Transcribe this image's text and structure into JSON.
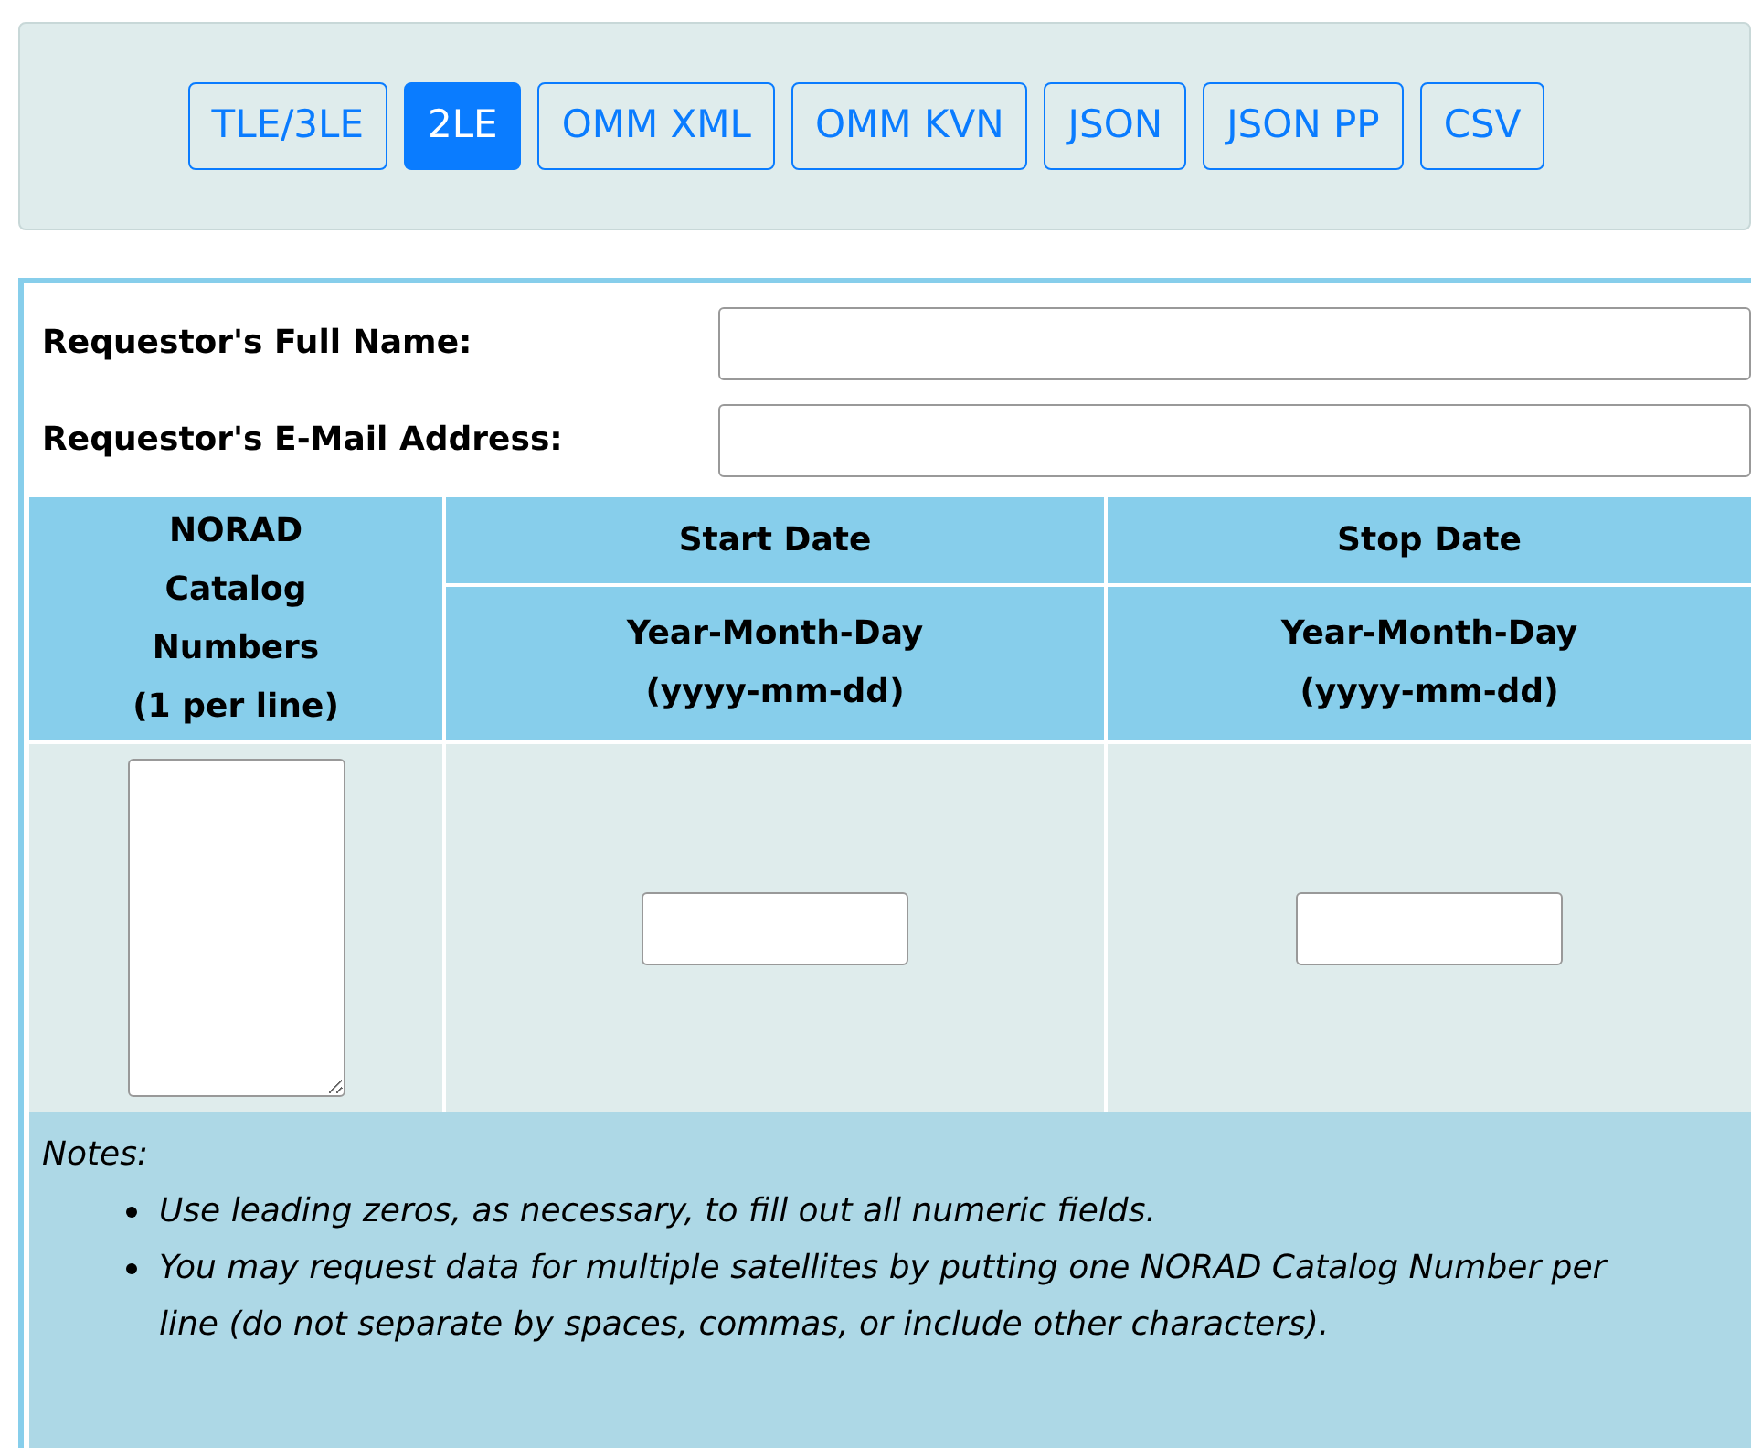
{
  "format_tabs": [
    {
      "label": "TLE/3LE",
      "selected": false
    },
    {
      "label": "2LE",
      "selected": true
    },
    {
      "label": "OMM XML",
      "selected": false
    },
    {
      "label": "OMM KVN",
      "selected": false
    },
    {
      "label": "JSON",
      "selected": false
    },
    {
      "label": "JSON PP",
      "selected": false
    },
    {
      "label": "CSV",
      "selected": false
    }
  ],
  "fields": [
    {
      "label": "Requestor's Full Name:"
    },
    {
      "label": "Requestor's E-Mail Address:"
    }
  ],
  "table": {
    "catalog_header": [
      "NORAD",
      "Catalog",
      "Numbers",
      "(1 per line)"
    ],
    "date_columns": [
      {
        "title": "Start Date",
        "format": [
          "Year-Month-Day",
          "(yyyy-mm-dd)"
        ]
      },
      {
        "title": "Stop Date",
        "format": [
          "Year-Month-Day",
          "(yyyy-mm-dd)"
        ]
      }
    ]
  },
  "notes": {
    "title": "Notes:",
    "items": [
      "Use leading zeros, as necessary, to fill out all numeric fields.",
      "You may request data for multiple satellites by putting one NORAD Catalog Number per line (do not separate by spaces, commas, or include other characters)."
    ]
  }
}
